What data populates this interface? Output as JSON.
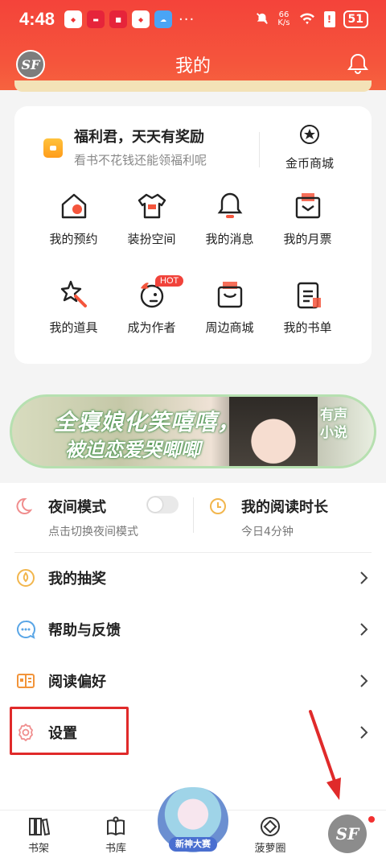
{
  "status_bar": {
    "time": "4:48",
    "net_speed_value": "66",
    "net_speed_unit": "K/s",
    "battery": "51",
    "dots": "···"
  },
  "header": {
    "title": "我的",
    "avatar_text": "SF"
  },
  "welfare": {
    "title": "福利君，天天有奖励",
    "subtitle": "看书不花钱还能领福利呢",
    "coin_shop": "金币商城"
  },
  "grid": {
    "items": [
      {
        "label": "我的预约",
        "icon": "home-reserve-icon"
      },
      {
        "label": "装扮空间",
        "icon": "shirt-icon"
      },
      {
        "label": "我的消息",
        "icon": "bell-icon"
      },
      {
        "label": "我的月票",
        "icon": "ticket-icon"
      },
      {
        "label": "我的道具",
        "icon": "star-wand-icon"
      },
      {
        "label": "成为作者",
        "icon": "author-icon"
      },
      {
        "label": "周边商城",
        "icon": "shopping-bag-icon"
      },
      {
        "label": "我的书单",
        "icon": "booklist-icon"
      }
    ],
    "hot_badge": "HOT"
  },
  "promo": {
    "line1": "全寝娘化笑嘻嘻，",
    "line2": "被迫恋爱哭唧唧",
    "tag": "有声小说"
  },
  "night_mode": {
    "title": "夜间模式",
    "subtitle": "点击切换夜间模式",
    "enabled": false
  },
  "reading_time": {
    "title": "我的阅读时长",
    "subtitle": "今日4分钟"
  },
  "menu": [
    {
      "label": "我的抽奖",
      "icon": "lottery-icon"
    },
    {
      "label": "帮助与反馈",
      "icon": "help-chat-icon"
    },
    {
      "label": "阅读偏好",
      "icon": "reading-pref-icon"
    },
    {
      "label": "设置",
      "icon": "settings-gear-icon"
    }
  ],
  "bottom_nav": {
    "bookshelf": "书架",
    "library": "书库",
    "mascot_tag": "新神大赛",
    "pineapple_circle": "菠萝圈",
    "avatar_text": "SF"
  },
  "colors": {
    "header_red": "#f4433a",
    "highlight_red": "#e02a2a",
    "accent_orange": "#ff9c1a"
  }
}
